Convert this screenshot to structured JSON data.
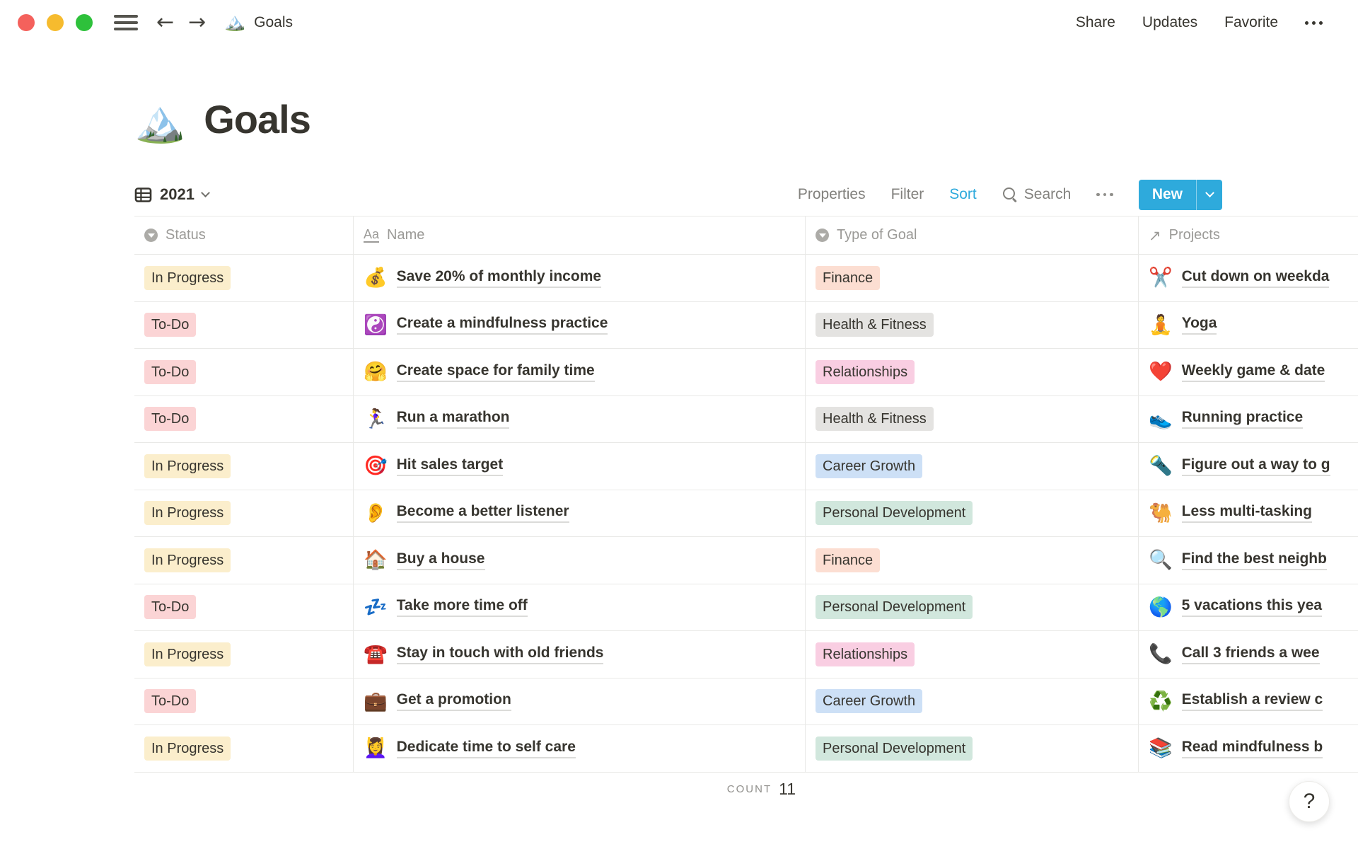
{
  "palette": {
    "accent": "#2EAADC",
    "yellow": "#FBEECC",
    "red": "#FBD4D5",
    "orange": "#FCDED2",
    "gray": "#E4E3E1",
    "pink": "#F9CEE2",
    "blue": "#CDE0F6",
    "green": "#D1E7DD"
  },
  "topbar": {
    "favicon": "🏔️",
    "breadcrumb": "Goals",
    "share_label": "Share",
    "updates_label": "Updates",
    "favorite_label": "Favorite"
  },
  "page": {
    "icon": "🏔️",
    "title": "Goals"
  },
  "view_bar": {
    "view_name": "2021",
    "properties_label": "Properties",
    "filter_label": "Filter",
    "sort_label": "Sort",
    "search_label": "Search",
    "new_label": "New"
  },
  "table": {
    "columns": [
      {
        "label": "Status",
        "icon": "select-icon"
      },
      {
        "label": "Name",
        "icon": "text-icon"
      },
      {
        "label": "Type of Goal",
        "icon": "select-icon"
      },
      {
        "label": "Projects",
        "icon": "relation-arrow-icon"
      }
    ],
    "rows": [
      {
        "status": "In Progress",
        "status_color": "yellow",
        "icon": "💰",
        "name": "Save 20% of monthly income",
        "type": "Finance",
        "type_color": "orange",
        "project_icon": "✂️",
        "project": "Cut down on weekda"
      },
      {
        "status": "To-Do",
        "status_color": "red",
        "icon": "☯️",
        "name": "Create a mindfulness practice",
        "type": "Health & Fitness",
        "type_color": "gray",
        "project_icon": "🧘",
        "project": "Yoga"
      },
      {
        "status": "To-Do",
        "status_color": "red",
        "icon": "🤗",
        "name": "Create space for family time",
        "type": "Relationships",
        "type_color": "pink",
        "project_icon": "❤️",
        "project": "Weekly game & date"
      },
      {
        "status": "To-Do",
        "status_color": "red",
        "icon": "🏃‍♀️",
        "name": "Run a marathon",
        "type": "Health & Fitness",
        "type_color": "gray",
        "project_icon": "👟",
        "project": "Running practice"
      },
      {
        "status": "In Progress",
        "status_color": "yellow",
        "icon": "🎯",
        "name": "Hit sales target",
        "type": "Career Growth",
        "type_color": "blue",
        "project_icon": "🔦",
        "project": "Figure out a way to g"
      },
      {
        "status": "In Progress",
        "status_color": "yellow",
        "icon": "👂",
        "name": "Become a better listener",
        "type": "Personal Development",
        "type_color": "green",
        "project_icon": "🐫",
        "project": "Less multi-tasking"
      },
      {
        "status": "In Progress",
        "status_color": "yellow",
        "icon": "🏠",
        "name": "Buy a house",
        "type": "Finance",
        "type_color": "orange",
        "project_icon": "🔍",
        "project": "Find the best neighb"
      },
      {
        "status": "To-Do",
        "status_color": "red",
        "icon": "💤",
        "name": "Take more time off",
        "type": "Personal Development",
        "type_color": "green",
        "project_icon": "🌎",
        "project": "5 vacations this yea"
      },
      {
        "status": "In Progress",
        "status_color": "yellow",
        "icon": "☎️",
        "name": "Stay in touch with old friends",
        "type": "Relationships",
        "type_color": "pink",
        "project_icon": "📞",
        "project": "Call 3 friends a wee"
      },
      {
        "status": "To-Do",
        "status_color": "red",
        "icon": "💼",
        "name": "Get a promotion",
        "type": "Career Growth",
        "type_color": "blue",
        "project_icon": "♻️",
        "project": "Establish a review c"
      },
      {
        "status": "In Progress",
        "status_color": "yellow",
        "icon": "💆‍♀️",
        "name": "Dedicate time to self care",
        "type": "Personal Development",
        "type_color": "green",
        "project_icon": "📚",
        "project": "Read mindfulness b"
      }
    ],
    "count_label": "COUNT",
    "count_value": "11"
  },
  "help": {
    "label": "?"
  }
}
